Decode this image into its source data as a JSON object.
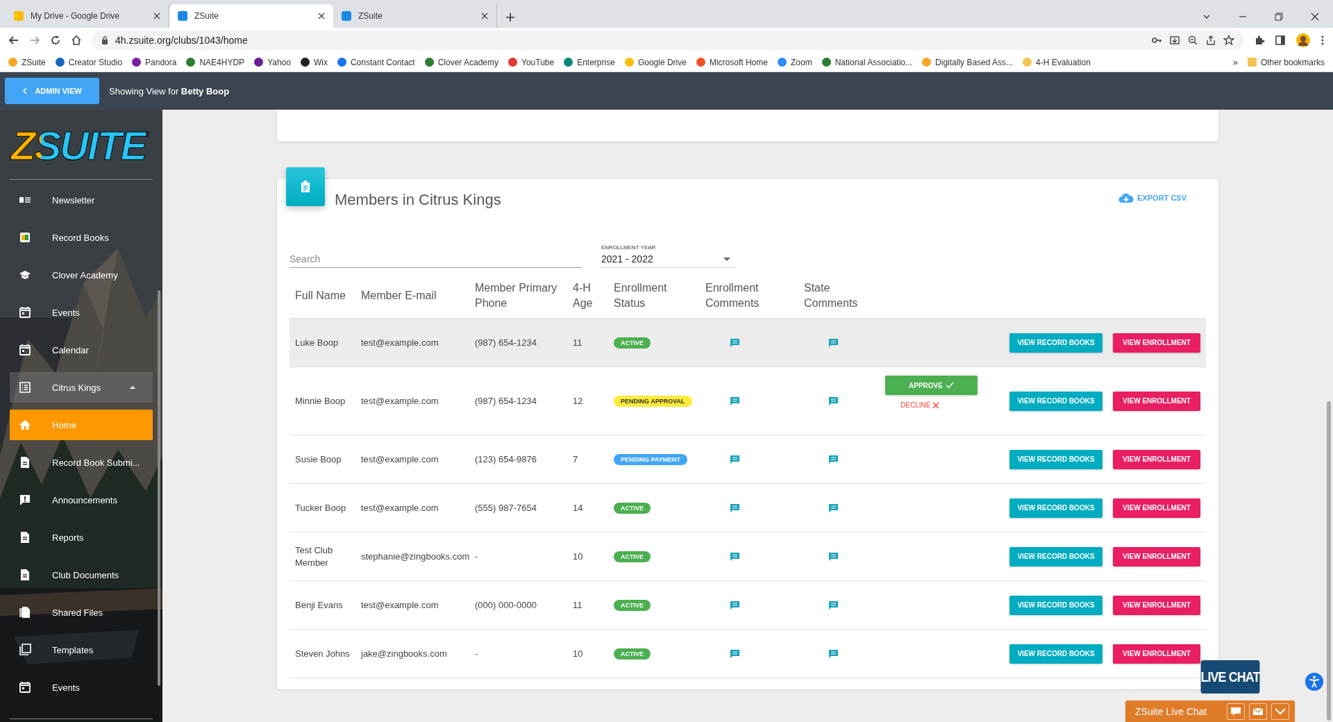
{
  "browser": {
    "tabs": [
      {
        "title": "My Drive - Google Drive",
        "selected": false
      },
      {
        "title": "ZSuite",
        "selected": true
      },
      {
        "title": "ZSuite",
        "selected": false
      }
    ],
    "url": "4h.zsuite.org/clubs/1043/home",
    "bookmarks": [
      "ZSuite",
      "Creator Studio",
      "Pandora",
      "NAE4HYDP",
      "Yahoo",
      "Wix",
      "Constant Contact",
      "Clover Academy",
      "YouTube",
      "Enterprise",
      "Google Drive",
      "Microsoft Home",
      "Zoom",
      "National Associatio...",
      "Digitally Based Ass...",
      "4-H Evaluation"
    ],
    "overflow": "»",
    "other_bookmarks": "Other bookmarks"
  },
  "admin_bar": {
    "button": "ADMIN VIEW",
    "showing": "Showing View for **Betty Boop**"
  },
  "sidebar": {
    "logo": "ZSUITE",
    "items": [
      {
        "label": "Newsletter",
        "kind": "item",
        "selected": false
      },
      {
        "label": "Record Books",
        "kind": "item",
        "selected": false
      },
      {
        "label": "Clover Academy",
        "kind": "item",
        "selected": false
      },
      {
        "label": "Events",
        "kind": "item",
        "selected": false
      },
      {
        "label": "Calendar",
        "kind": "item",
        "selected": false
      },
      {
        "label": "Citrus Kings",
        "kind": "group",
        "selected": false,
        "expanded": true
      },
      {
        "label": "Home",
        "kind": "item",
        "selected": true
      },
      {
        "label": "Record Book Submi...",
        "kind": "item",
        "selected": false
      },
      {
        "label": "Announcements",
        "kind": "item",
        "selected": false
      },
      {
        "label": "Reports",
        "kind": "item",
        "selected": false
      },
      {
        "label": "Club Documents",
        "kind": "item",
        "selected": false
      },
      {
        "label": "Shared Files",
        "kind": "item",
        "selected": false
      },
      {
        "label": "Templates",
        "kind": "item",
        "selected": false
      },
      {
        "label": "Events",
        "kind": "item",
        "selected": false
      }
    ]
  },
  "members": {
    "title": "Members in Citrus Kings",
    "export": "EXPORT CSV",
    "search": {
      "placeholder": "Search"
    },
    "enrollment_year": {
      "label": "ENROLLMENT YEAR",
      "value": "2021 - 2022"
    },
    "columns": [
      "Full Name",
      "Member E-mail",
      "Member Primary Phone",
      "4-H Age",
      "Enrollment Status",
      "Enrollment Comments",
      "State Comments"
    ],
    "rows": [
      {
        "name": "Luke Boop",
        "email": "test@example.com",
        "phone": "(987) 654-1234",
        "age": "11",
        "status": {
          "label": "ACTIVE",
          "kind": "active"
        },
        "selected": true,
        "actions": [
          "VIEW RECORD BOOKS",
          "VIEW ENROLLMENT"
        ]
      },
      {
        "name": "Minnie Boop",
        "email": "test@example.com",
        "phone": "(987) 654-1234",
        "age": "12",
        "status": {
          "label": "PENDING APPROVAL",
          "kind": "pending_approval"
        },
        "selected": false,
        "approve": "APPROVE",
        "decline": "DECLINE",
        "actions": [
          "VIEW RECORD BOOKS",
          "VIEW ENROLLMENT"
        ]
      },
      {
        "name": "Susie Boop",
        "email": "test@example.com",
        "phone": "(123) 654-9876",
        "age": "7",
        "status": {
          "label": "PENDING PAYMENT",
          "kind": "pending_payment"
        },
        "selected": false,
        "actions": [
          "VIEW RECORD BOOKS",
          "VIEW ENROLLMENT"
        ]
      },
      {
        "name": "Tucker Boop",
        "email": "test@example.com",
        "phone": "(555) 987-7654",
        "age": "14",
        "status": {
          "label": "ACTIVE",
          "kind": "active"
        },
        "selected": false,
        "actions": [
          "VIEW RECORD BOOKS",
          "VIEW ENROLLMENT"
        ]
      },
      {
        "name": "Test Club Member",
        "email": "stephanie@zingbooks.com",
        "phone": "-",
        "age": "10",
        "status": {
          "label": "ACTIVE",
          "kind": "active"
        },
        "selected": false,
        "actions": [
          "VIEW RECORD BOOKS",
          "VIEW ENROLLMENT"
        ]
      },
      {
        "name": "Benji Evans",
        "email": "test@example.com",
        "phone": "(000) 000-0000",
        "age": "11",
        "status": {
          "label": "ACTIVE",
          "kind": "active"
        },
        "selected": false,
        "actions": [
          "VIEW RECORD BOOKS",
          "VIEW ENROLLMENT"
        ]
      },
      {
        "name": "Steven Johns",
        "email": "jake@zingbooks.com",
        "phone": "-",
        "age": "10",
        "status": {
          "label": "ACTIVE",
          "kind": "active"
        },
        "selected": false,
        "actions": [
          "VIEW RECORD BOOKS",
          "VIEW ENROLLMENT"
        ]
      }
    ]
  },
  "live_chat": {
    "badge": "LIVE CHAT",
    "bar": "ZSuite Live Chat"
  }
}
